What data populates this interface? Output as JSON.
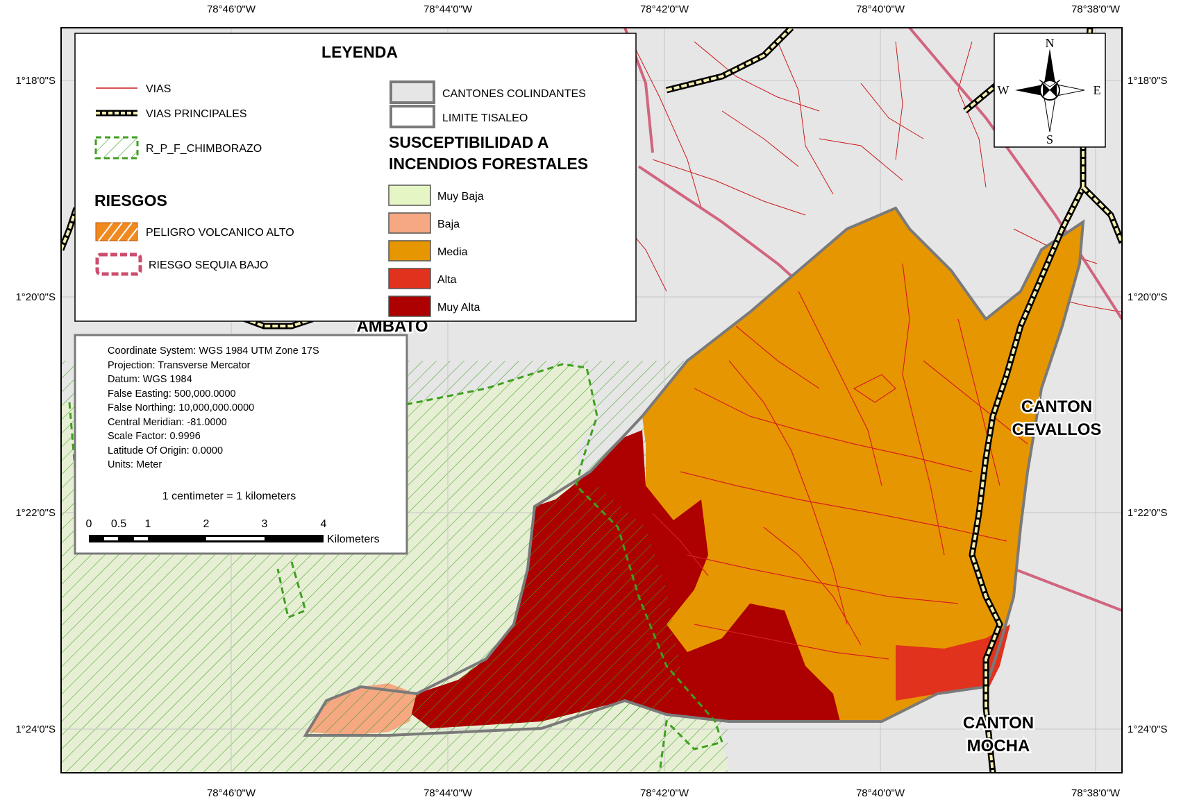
{
  "map": {
    "coords": {
      "top_lon": [
        "78°46'0\"W",
        "78°44'0\"W",
        "78°42'0\"W",
        "78°40'0\"W",
        "78°38'0\"W"
      ],
      "bottom_lon": [
        "78°46'0\"W",
        "78°44'0\"W",
        "78°42'0\"W",
        "78°40'0\"W",
        "78°38'0\"W"
      ],
      "left_lat": [
        "1°18'0\"S",
        "1°20'0\"S",
        "1°22'0\"S",
        "1°24'0\"S"
      ],
      "right_lat": [
        "1°18'0\"S",
        "1°20'0\"S",
        "1°22'0\"S",
        "1°24'0\"S"
      ]
    },
    "place_labels": {
      "ambato": "AMBATO",
      "cevallos_1": "CANTON",
      "cevallos_2": "CEVALLOS",
      "mocha_1": "CANTON",
      "mocha_2": "MOCHA"
    },
    "colors": {
      "background": "#e6e6e6",
      "muy_baja": "#e5f6c4",
      "baja": "#f6a883",
      "media": "#e69600",
      "alta": "#e0321c",
      "muy_alta": "#ad0000",
      "vias": "#cc1a1a",
      "reserve": "#3f9f1f",
      "sequia": "#cc4d6c"
    }
  },
  "legend": {
    "title": "LEYENDA",
    "vias": "VIAS",
    "vias_principales": "VIAS PRINCIPALES",
    "reserva": "R_P_F_CHIMBORAZO",
    "riesgos_title": "RIESGOS",
    "peligro": "PELIGRO VOLCANICO ALTO",
    "sequia": "RIESGO SEQUIA BAJO",
    "cantones": "CANTONES COLINDANTES",
    "limite": "LIMITE TISALEO",
    "suscept_1": "SUSCEPTIBILIDAD A",
    "suscept_2": "INCENDIOS FORESTALES",
    "classes": [
      "Muy Baja",
      "Baja",
      "Media",
      "Alta",
      "Muy Alta"
    ]
  },
  "info": {
    "lines": [
      "Coordinate System: WGS 1984 UTM Zone 17S",
      "Projection: Transverse Mercator",
      "Datum: WGS 1984",
      "False Easting: 500,000.0000",
      "False Northing: 10,000,000.0000",
      "Central Meridian: -81.0000",
      "Scale Factor: 0.9996",
      "Latitude Of Origin: 0.0000",
      "Units: Meter"
    ],
    "scale_text": "1 centimeter = 1 kilometers",
    "scale_ticks": [
      "0",
      "0.5",
      "1",
      "2",
      "3",
      "4"
    ],
    "scale_unit": "Kilometers"
  },
  "compass": {
    "n": "N",
    "s": "S",
    "e": "E",
    "w": "W"
  }
}
